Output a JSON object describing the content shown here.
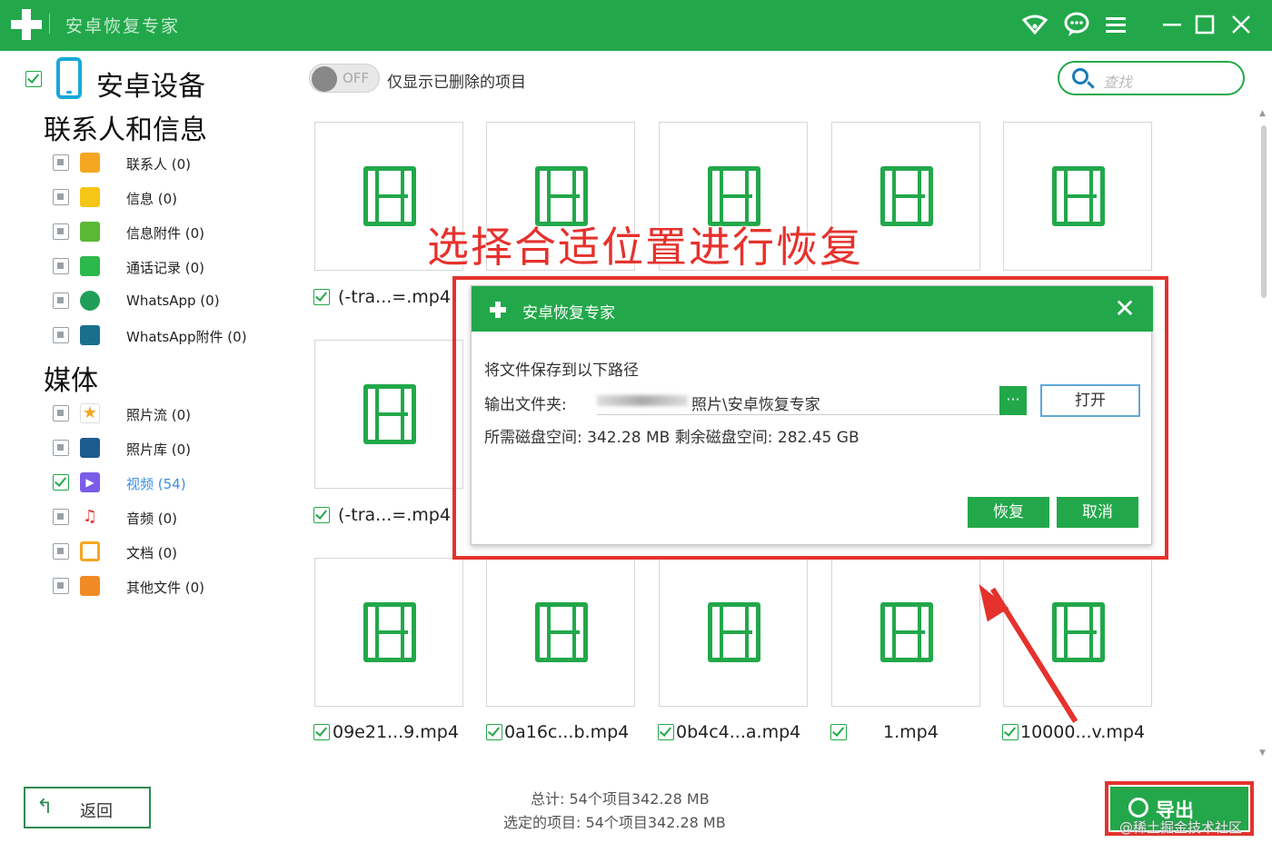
{
  "app": {
    "title": "安卓恢复专家"
  },
  "titlebar": {
    "icons": [
      "wifi-icon",
      "chat-icon",
      "menu-icon",
      "minimize-icon",
      "maximize-icon",
      "close-icon"
    ]
  },
  "sidebar": {
    "device_title": "安卓设备",
    "section_contacts": "联系人和信息",
    "section_media": "媒体",
    "contacts_items": [
      {
        "label": "联系人 (0)",
        "icon": "contacts-icon",
        "color": "#f5a623"
      },
      {
        "label": "信息 (0)",
        "icon": "message-icon",
        "color": "#f5c518"
      },
      {
        "label": "信息附件 (0)",
        "icon": "attachment-icon",
        "color": "#5ab835"
      },
      {
        "label": "通话记录 (0)",
        "icon": "phone-icon",
        "color": "#2db84c"
      },
      {
        "label": "WhatsApp (0)",
        "icon": "whatsapp-icon",
        "color": "#1f9e57"
      },
      {
        "label": "WhatsApp附件 (0)",
        "icon": "whatsapp-attachment-icon",
        "color": "#1a6f8e"
      }
    ],
    "media_items": [
      {
        "label": "照片流 (0)",
        "icon": "photo-stream-icon",
        "color": "#f5a623",
        "checked": false
      },
      {
        "label": "照片库 (0)",
        "icon": "photo-library-icon",
        "color": "#1e5b8f",
        "checked": false
      },
      {
        "label": "视频 (54)",
        "icon": "video-icon",
        "color": "#7b5ce6",
        "checked": true
      },
      {
        "label": "音频 (0)",
        "icon": "audio-icon",
        "color": "#e5322d",
        "checked": false
      },
      {
        "label": "文档 (0)",
        "icon": "document-icon",
        "color": "#f5a623",
        "checked": false
      },
      {
        "label": "其他文件 (0)",
        "icon": "other-files-icon",
        "color": "#f08a24",
        "checked": false
      }
    ]
  },
  "topbar": {
    "toggle_text": "OFF",
    "toggle_label": "仅显示已删除的项目",
    "search_placeholder": "查找"
  },
  "files": {
    "row1_label": "(-tra...=.mp4",
    "row2_label": "(-tra...=.mp4",
    "row3_labels": [
      "09e21...9.mp4",
      "0a16c...b.mp4",
      "0b4c4...a.mp4",
      "1.mp4",
      "10000...v.mp4"
    ]
  },
  "annotation": {
    "text": "选择合适位置进行恢复"
  },
  "dialog": {
    "title": "安卓恢复专家",
    "save_prompt": "将文件保存到以下路径",
    "output_label": "输出文件夹:",
    "output_path": "照片\\安卓恢复专家",
    "browse_label": "···",
    "open_label": "打开",
    "space_line": "所需磁盘空间:  342.28 MB  剩余磁盘空间:  282.45 GB",
    "recover_label": "恢复",
    "cancel_label": "取消"
  },
  "footer": {
    "back_label": "返回",
    "total_line": "总计: 54个项目342.28 MB",
    "selected_line": "选定的项目: 54个项目342.28 MB",
    "export_label": "导出",
    "watermark": "@稀土掘金技术社区"
  }
}
